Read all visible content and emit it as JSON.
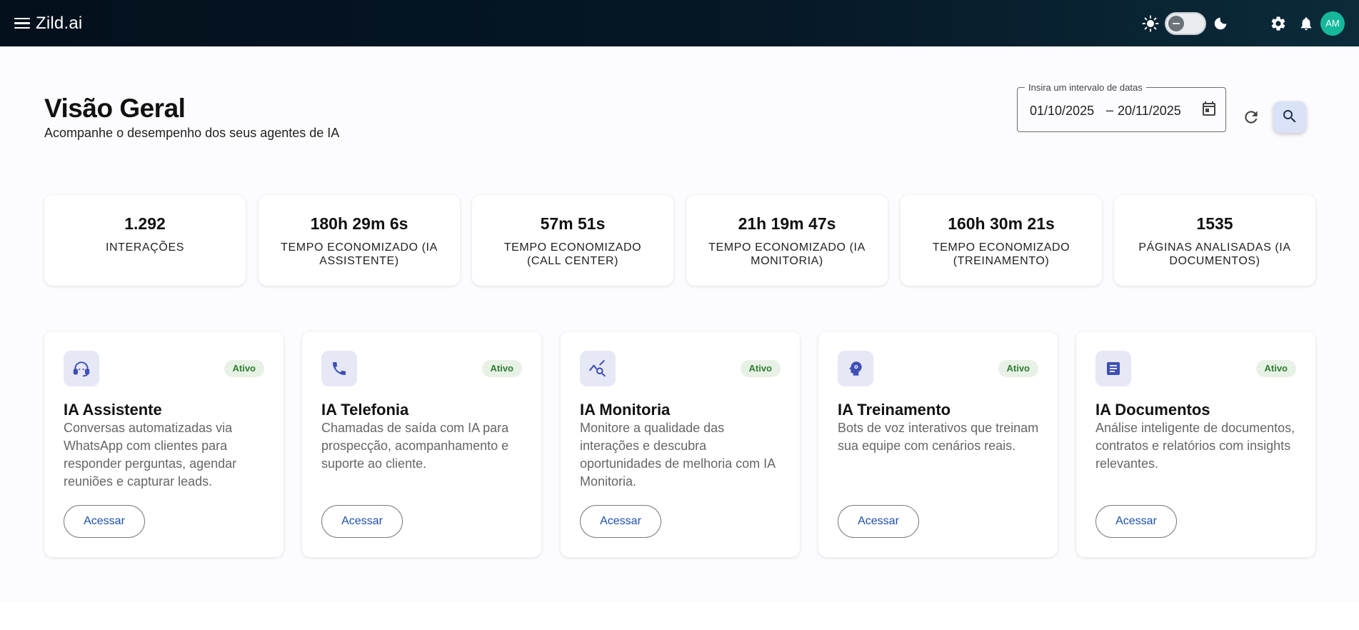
{
  "app": {
    "brand": "Zild.ai",
    "user_initials": "AM"
  },
  "header": {
    "title": "Visão Geral",
    "subtitle": "Acompanhe o desempenho dos seus agentes de IA"
  },
  "date_range": {
    "legend": "Insira um intervalo de datas",
    "start": "01/10/2025",
    "separator": "–",
    "end": "20/11/2025"
  },
  "stats": [
    {
      "value": "1.292",
      "label": "INTERAÇÕES"
    },
    {
      "value": "180h 29m 6s",
      "label": "TEMPO ECONOMIZADO (IA ASSISTENTE)"
    },
    {
      "value": "57m 51s",
      "label": "TEMPO ECONOMIZADO (CALL CENTER)"
    },
    {
      "value": "21h 19m 47s",
      "label": "TEMPO ECONOMIZADO (IA MONITORIA)"
    },
    {
      "value": "160h 30m 21s",
      "label": "TEMPO ECONOMIZADO (TREINAMENTO)"
    },
    {
      "value": "1535",
      "label": "PÁGINAS ANALISADAS (IA DOCUMENTOS)"
    }
  ],
  "agents": [
    {
      "title": "IA Assistente",
      "status": "Ativo",
      "description": "Conversas automatizadas via WhatsApp com clientes para responder perguntas, agendar reuniões e capturar leads.",
      "button": "Acessar",
      "icon": "headset-icon"
    },
    {
      "title": "IA Telefonia",
      "status": "Ativo",
      "description": "Chamadas de saída com IA para prospecção, acompanhamento e suporte ao cliente.",
      "button": "Acessar",
      "icon": "phone-icon"
    },
    {
      "title": "IA Monitoria",
      "status": "Ativo",
      "description": "Monitore a qualidade das interações e descubra oportunidades de melhoria com IA Monitoria.",
      "button": "Acessar",
      "icon": "query-stats-icon"
    },
    {
      "title": "IA Treinamento",
      "status": "Ativo",
      "description": "Bots de voz interativos que treinam sua equipe com cenários reais.",
      "button": "Acessar",
      "icon": "psychology-icon"
    },
    {
      "title": "IA Documentos",
      "status": "Ativo",
      "description": "Análise inteligente de documentos, contratos e relatórios com insights relevantes.",
      "button": "Acessar",
      "icon": "document-icon"
    }
  ],
  "colors": {
    "accent": "#3f4fb5",
    "status_green": "#2e7d32",
    "avatar": "#16b89c"
  }
}
